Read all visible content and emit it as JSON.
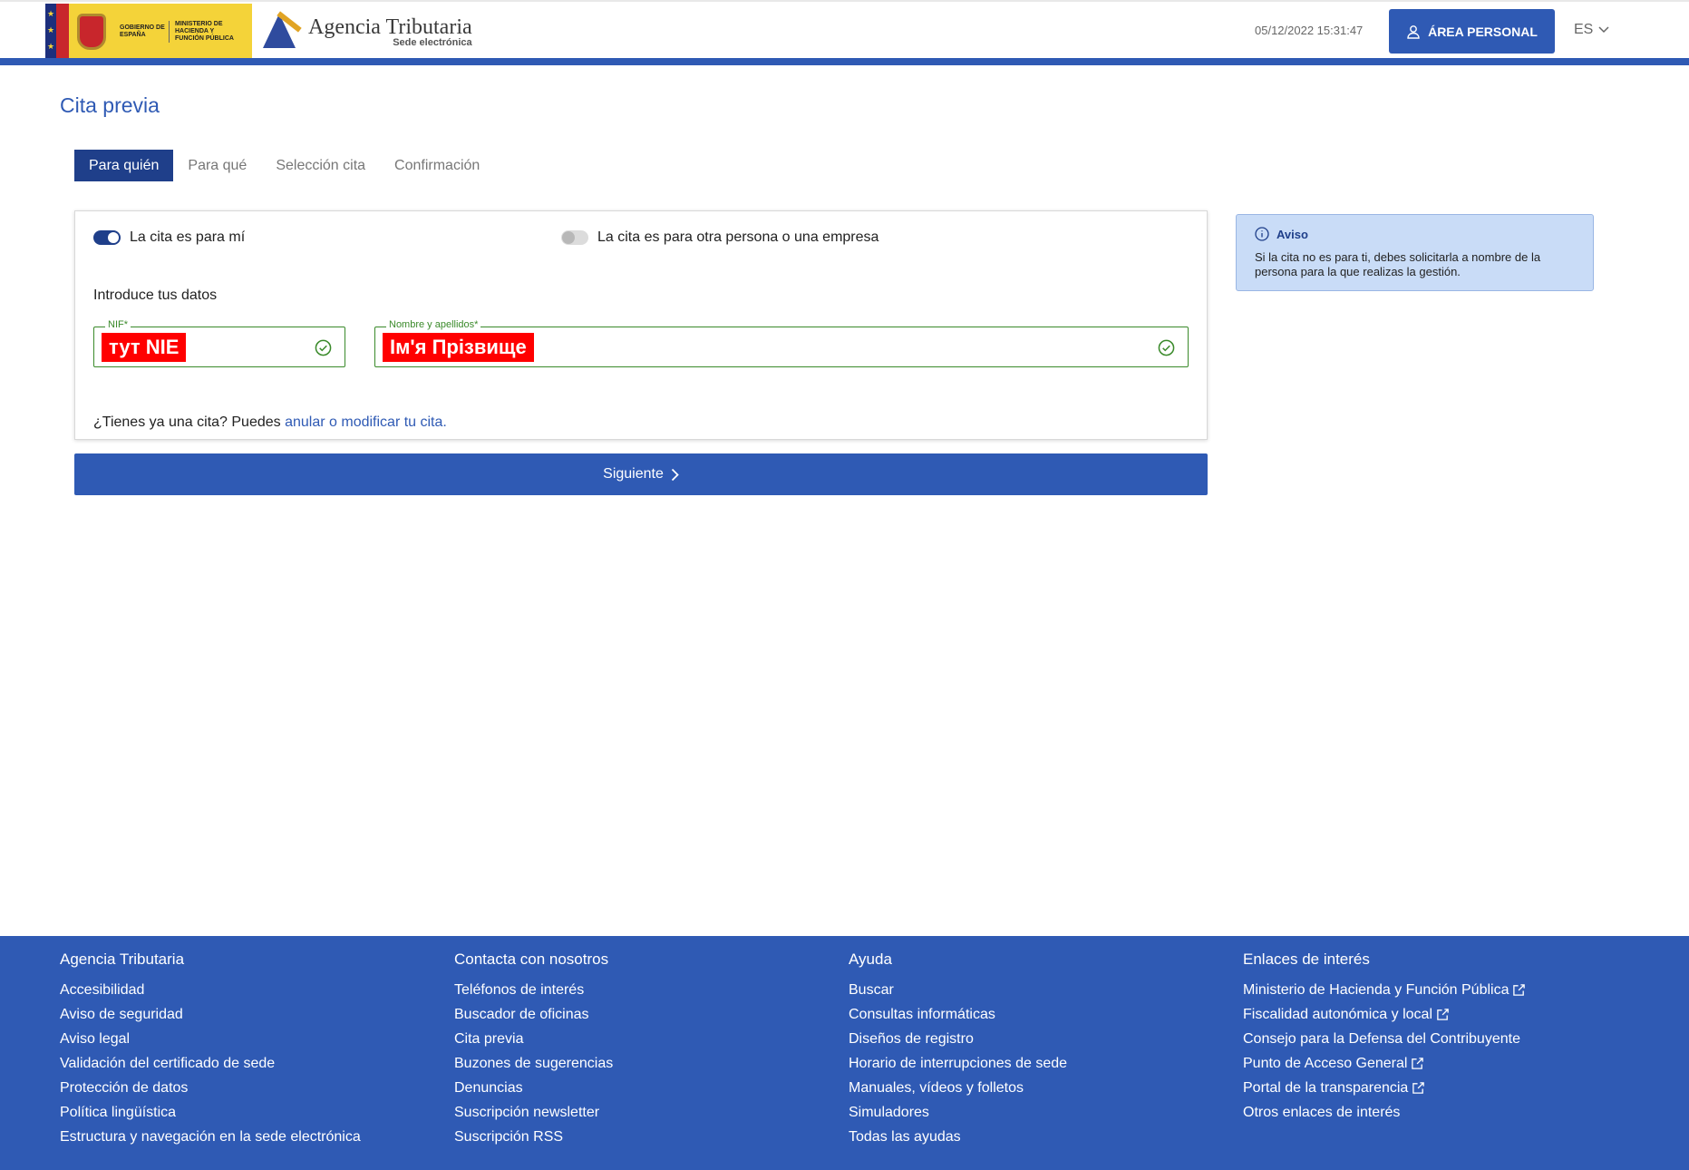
{
  "header": {
    "gov_label_1": "GOBIERNO DE ESPAÑA",
    "gov_label_2": "MINISTERIO DE HACIENDA Y FUNCIÓN PÚBLICA",
    "agency_name": "Agencia Tributaria",
    "agency_sub": "Sede electrónica",
    "datetime": "05/12/2022 15:31:47",
    "area_personal": "ÁREA PERSONAL",
    "language": "ES"
  },
  "page": {
    "title": "Cita previa",
    "tabs": [
      {
        "label": "Para quién",
        "active": true
      },
      {
        "label": "Para qué",
        "active": false
      },
      {
        "label": "Selección cita",
        "active": false
      },
      {
        "label": "Confirmación",
        "active": false
      }
    ]
  },
  "form": {
    "toggle_self_label": "La cita es para mí",
    "toggle_self_on": true,
    "toggle_other_label": "La cita es para otra persona o una empresa",
    "toggle_other_on": false,
    "intro": "Introduce tus datos",
    "nif_label": "NIF*",
    "nif_value": "тут NIE",
    "name_label": "Nombre y apellidos*",
    "name_value": "Ім'я Прізвище",
    "existing_prefix": "¿Tienes ya una cita? Puedes ",
    "existing_link": "anular o modificar tu cita.",
    "next_button": "Siguiente"
  },
  "notice": {
    "title": "Aviso",
    "text": "Si la cita no es para ti, debes solicitarla a nombre de la persona para la que realizas la gestión."
  },
  "footer": {
    "col1": {
      "title": "Agencia Tributaria",
      "links": [
        "Accesibilidad",
        "Aviso de seguridad",
        "Aviso legal",
        "Validación del certificado de sede",
        "Protección de datos",
        "Política lingüística",
        "Estructura y navegación en la sede electrónica"
      ]
    },
    "col2": {
      "title": "Contacta con nosotros",
      "links": [
        "Teléfonos de interés",
        "Buscador de oficinas",
        "Cita previa",
        "Buzones de sugerencias",
        "Denuncias",
        "Suscripción newsletter",
        "Suscripción RSS"
      ]
    },
    "col3": {
      "title": "Ayuda",
      "links": [
        "Buscar",
        "Consultas informáticas",
        "Diseños de registro",
        "Horario de interrupciones de sede",
        "Manuales, vídeos y folletos",
        "Simuladores",
        "Todas las ayudas"
      ]
    },
    "col4": {
      "title": "Enlaces de interés",
      "links": [
        "Ministerio de Hacienda y Función Pública",
        "Fiscalidad autonómica y local",
        "Consejo para la Defensa del Contribuyente",
        "Punto de Acceso General",
        "Portal de la transparencia",
        "Otros enlaces de interés"
      ]
    }
  },
  "colors": {
    "primary": "#2f5ab4",
    "primary_dark": "#1f3f8a",
    "valid_green": "#3a8a2a",
    "highlight_red": "#ff0000",
    "notice_bg": "#c9dcf7"
  }
}
